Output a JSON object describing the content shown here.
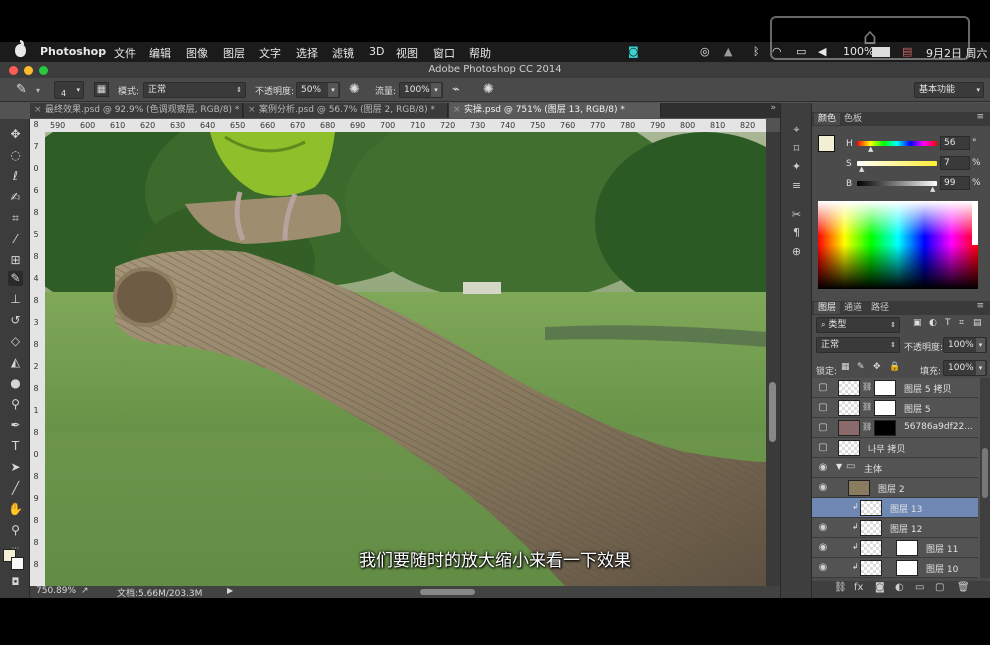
{
  "menubar": {
    "app_name": "Photoshop",
    "items": [
      "文件",
      "编辑",
      "图像",
      "图层",
      "文字",
      "选择",
      "滤镜",
      "3D",
      "视图",
      "窗口",
      "帮助"
    ],
    "battery": "100%",
    "clock": "9月2日 周六"
  },
  "window": {
    "title": "Adobe Photoshop CC 2014"
  },
  "options": {
    "brush_size": "4",
    "mode_label": "模式:",
    "mode_value": "正常",
    "opacity_label": "不透明度:",
    "opacity_value": "50%",
    "flow_label": "流量:",
    "flow_value": "100%",
    "workspace": "基本功能"
  },
  "tabs": [
    {
      "label": "最终效果.psd @ 92.9% (色调观察层, RGB/8) *"
    },
    {
      "label": "案例分析.psd @ 56.7% (图层 2, RGB/8) *"
    },
    {
      "label": "实操.psd @ 751% (图层 13, RGB/8) *"
    }
  ],
  "ruler": {
    "h": [
      "590",
      "600",
      "610",
      "620",
      "630",
      "640",
      "650",
      "660",
      "670",
      "680",
      "690",
      "700",
      "710",
      "720",
      "730",
      "740",
      "750",
      "760",
      "770",
      "780",
      "790",
      "800",
      "810",
      "820"
    ],
    "v": [
      "8",
      "7",
      "0",
      "6",
      "8",
      "5",
      "8",
      "4",
      "8",
      "3",
      "8",
      "2",
      "8",
      "1",
      "8",
      "0",
      "8",
      "9",
      "8",
      "8",
      "8"
    ]
  },
  "status": {
    "zoom": "750.89%",
    "doc": "文档:5.66M/203.3M"
  },
  "subtitle": "我们要随时的放大缩小来看一下效果",
  "color_panel": {
    "tabs": [
      "颜色",
      "色板"
    ],
    "h_label": "H",
    "h_value": "56",
    "s_label": "S",
    "s_value": "7",
    "b_label": "B",
    "b_value": "99",
    "pct": "%",
    "deg": "°"
  },
  "layers_panel": {
    "tabs": [
      "图层",
      "通道",
      "路径"
    ],
    "filter": "类型",
    "blend_mode": "正常",
    "opacity_label": "不透明度:",
    "opacity_value": "100%",
    "lock_label": "锁定:",
    "fill_label": "填充:",
    "fill_value": "100%",
    "layers": [
      {
        "name": "图层 5 拷贝"
      },
      {
        "name": "图层 5"
      },
      {
        "name": "56786a9df22..."
      },
      {
        "name": "나무 拷贝"
      },
      {
        "name": "主体"
      },
      {
        "name": "图层 2"
      },
      {
        "name": "图层 13"
      },
      {
        "name": "图层 12"
      },
      {
        "name": "图层 11"
      },
      {
        "name": "图层 10"
      }
    ]
  },
  "colors": {
    "accent": "#6b7fa8",
    "selected_layer": "#6f88b3",
    "foreground": "#f3efd4"
  }
}
